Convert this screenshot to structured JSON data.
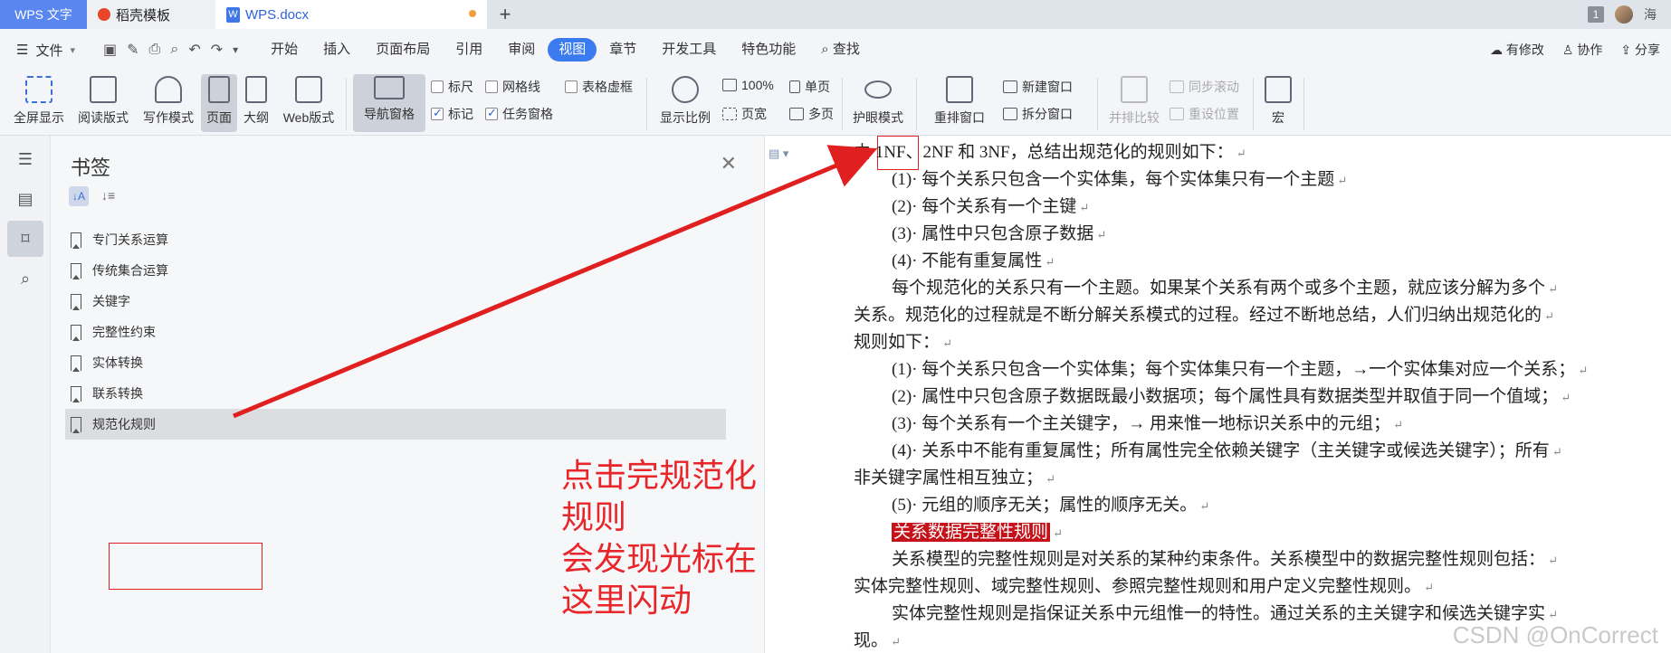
{
  "titlebar": {
    "app_tab": "WPS 文字",
    "template_tab": "稻壳模板",
    "doc_tab": "WPS.docx",
    "doc_icon": "W",
    "add_tab": "+",
    "counter": "1",
    "user": "海"
  },
  "menubar": {
    "file": "文件",
    "items": [
      "开始",
      "插入",
      "页面布局",
      "引用",
      "审阅",
      "视图",
      "章节",
      "开发工具",
      "特色功能"
    ],
    "active": "视图",
    "search": "查找",
    "right": [
      "有修改",
      "协作",
      "分享"
    ]
  },
  "ribbon": {
    "fullscreen": "全屏显示",
    "read_mode": "阅读版式",
    "write_mode": "写作模式",
    "page": "页面",
    "outline": "大纲",
    "web": "Web版式",
    "nav_pane": "导航窗格",
    "ruler": "标尺",
    "gridline": "网格线",
    "table_border": "表格虚框",
    "mark": "标记",
    "task_pane": "任务窗格",
    "zoom": "显示比例",
    "zoom_100": "100%",
    "page_width": "页宽",
    "single_page": "单页",
    "multi_page": "多页",
    "eye_mode": "护眼模式",
    "rearrange": "重排窗口",
    "new_window": "新建窗口",
    "split_window": "拆分窗口",
    "side_by_side": "并排比较",
    "sync_scroll": "同步滚动",
    "reset_pos": "重设位置",
    "macro": "宏"
  },
  "panel": {
    "title": "书签",
    "bookmarks": [
      "专门关系运算",
      "传统集合运算",
      "关键字",
      "完整性约束",
      "实体转换",
      "联系转换",
      "规范化规则"
    ],
    "selected": "规范化规则"
  },
  "annotation": {
    "line1": "点击完规范化规则",
    "line2": "会发现光标在这里闪动"
  },
  "document": {
    "lines": [
      {
        "t": "由 1NF、2NF 和 3NF，总结出规范化的规则如下：",
        "ind": false
      },
      {
        "t": "(1)· 每个关系只包含一个实体集，每个实体集只有一个主题",
        "ind": true
      },
      {
        "t": "(2)· 每个关系有一个主键",
        "ind": true
      },
      {
        "t": "(3)· 属性中只包含原子数据",
        "ind": true
      },
      {
        "t": "(4)· 不能有重复属性",
        "ind": true
      },
      {
        "t": "每个规范化的关系只有一个主题。如果某个关系有两个或多个主题，就应该分解为多个",
        "ind": true
      },
      {
        "t": "关系。规范化的过程就是不断分解关系模式的过程。经过不断地总结，人们归纳出规范化的",
        "ind": false
      },
      {
        "t": "规则如下：",
        "ind": false
      },
      {
        "t": "(1)· 每个关系只包含一个实体集；每个实体集只有一个主题，→一个实体集对应一个关系；",
        "ind": true
      },
      {
        "t": "(2)· 属性中只包含原子数据既最小数据项；每个属性具有数据类型并取值于同一个值域；",
        "ind": true
      },
      {
        "t": "(3)· 每个关系有一个主关键字，→ 用来惟一地标识关系中的元组；",
        "ind": true
      },
      {
        "t": "(4)· 关系中不能有重复属性；所有属性完全依赖关键字（主关键字或候选关键字）；所有",
        "ind": true
      },
      {
        "t": "非关键字属性相互独立；",
        "ind": false
      },
      {
        "t": "(5)· 元组的顺序无关；属性的顺序无关。",
        "ind": true
      },
      {
        "t": "关系数据完整性规则",
        "ind": true,
        "hl": true
      },
      {
        "t": "关系模型的完整性规则是对关系的某种约束条件。关系模型中的数据完整性规则包括：",
        "ind": true
      },
      {
        "t": "实体完整性规则、域完整性规则、参照完整性规则和用户定义完整性规则。",
        "ind": false
      },
      {
        "t": "实体完整性规则是指保证关系中元组惟一的特性。通过关系的主关键字和候选关键字实",
        "ind": true
      },
      {
        "t": "现。",
        "ind": false
      }
    ],
    "watermark": "CSDN @OnCorrect"
  }
}
